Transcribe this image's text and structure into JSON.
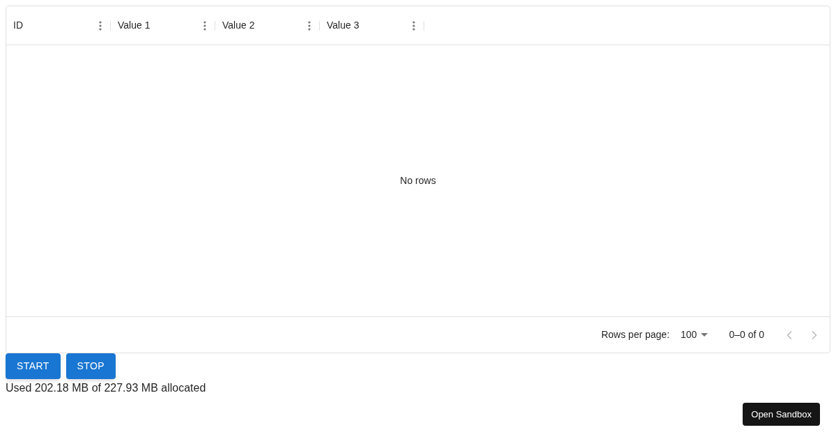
{
  "grid": {
    "columns": [
      {
        "label": "ID"
      },
      {
        "label": "Value 1"
      },
      {
        "label": "Value 2"
      },
      {
        "label": "Value 3"
      }
    ],
    "empty_message": "No rows",
    "footer": {
      "rows_per_page_label": "Rows per page:",
      "rows_per_page": "100",
      "range": "0–0 of 0",
      "prev_disabled": true,
      "next_disabled": true
    }
  },
  "buttons": [
    {
      "label": "START"
    },
    {
      "label": "STOP"
    }
  ],
  "memory_text": "Used 202.18 MB of 227.93 MB allocated",
  "sandbox_button": "Open Sandbox"
}
